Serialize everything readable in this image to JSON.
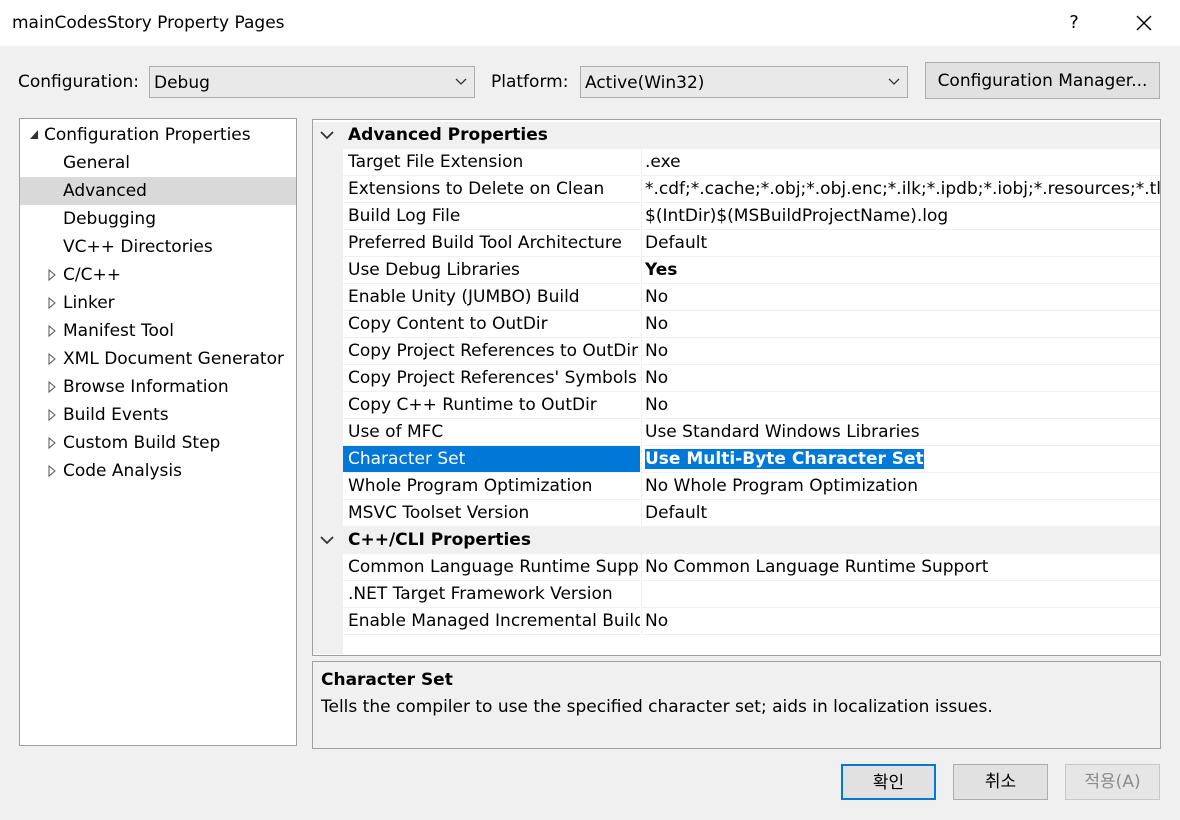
{
  "window": {
    "title": "mainCodesStory Property Pages",
    "help_label": "?",
    "close_label": "✕"
  },
  "toolbar": {
    "configuration_label": "Configuration:",
    "configuration_value": "Debug",
    "platform_label": "Platform:",
    "platform_value": "Active(Win32)",
    "config_manager_label": "Configuration Manager..."
  },
  "tree": {
    "items": [
      {
        "label": "Configuration Properties",
        "expander": "expanded"
      },
      {
        "label": "General",
        "expander": "none"
      },
      {
        "label": "Advanced",
        "expander": "none",
        "selected": true
      },
      {
        "label": "Debugging",
        "expander": "none"
      },
      {
        "label": "VC++ Directories",
        "expander": "none"
      },
      {
        "label": "C/C++",
        "expander": "collapsed"
      },
      {
        "label": "Linker",
        "expander": "collapsed"
      },
      {
        "label": "Manifest Tool",
        "expander": "collapsed"
      },
      {
        "label": "XML Document Generator",
        "expander": "collapsed"
      },
      {
        "label": "Browse Information",
        "expander": "collapsed"
      },
      {
        "label": "Build Events",
        "expander": "collapsed"
      },
      {
        "label": "Custom Build Step",
        "expander": "collapsed"
      },
      {
        "label": "Code Analysis",
        "expander": "collapsed"
      }
    ]
  },
  "grid": {
    "sections": [
      {
        "name": "Advanced Properties",
        "rows": [
          {
            "name": "Target File Extension",
            "value": ".exe"
          },
          {
            "name": "Extensions to Delete on Clean",
            "value": "*.cdf;*.cache;*.obj;*.obj.enc;*.ilk;*.ipdb;*.iobj;*.resources;*.tlb;*.tli;"
          },
          {
            "name": "Build Log File",
            "value": "$(IntDir)$(MSBuildProjectName).log"
          },
          {
            "name": "Preferred Build Tool Architecture",
            "value": "Default"
          },
          {
            "name": "Use Debug Libraries",
            "value": "Yes",
            "bold": true
          },
          {
            "name": "Enable Unity (JUMBO) Build",
            "value": "No"
          },
          {
            "name": "Copy Content to OutDir",
            "value": "No"
          },
          {
            "name": "Copy Project References to OutDir",
            "value": "No"
          },
          {
            "name": "Copy Project References' Symbols t",
            "value": "No"
          },
          {
            "name": "Copy C++ Runtime to OutDir",
            "value": "No"
          },
          {
            "name": "Use of MFC",
            "value": "Use Standard Windows Libraries"
          },
          {
            "name": "Character Set",
            "value": "Use Multi-Byte Character Set",
            "selected": true,
            "bold": true
          },
          {
            "name": "Whole Program Optimization",
            "value": "No Whole Program Optimization"
          },
          {
            "name": "MSVC Toolset Version",
            "value": "Default"
          }
        ]
      },
      {
        "name": "C++/CLI Properties",
        "rows": [
          {
            "name": "Common Language Runtime Suppo",
            "value": "No Common Language Runtime Support"
          },
          {
            "name": ".NET Target Framework Version",
            "value": ""
          },
          {
            "name": "Enable Managed Incremental Build",
            "value": "No"
          }
        ]
      }
    ]
  },
  "description": {
    "title": "Character Set",
    "text": "Tells the compiler to use the specified character set; aids in localization issues."
  },
  "buttons": {
    "ok": "확인",
    "cancel": "취소",
    "apply": "적용(A)"
  },
  "colors": {
    "selection": "#0078d7",
    "tree_selection": "#d9d9d9",
    "disabled_text": "#8c8c8c"
  }
}
